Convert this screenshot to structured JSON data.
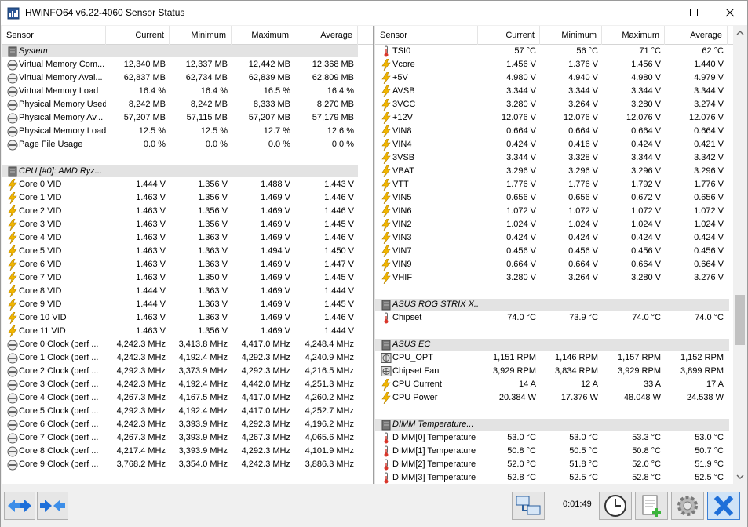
{
  "window": {
    "title": "HWiNFO64 v6.22-4060 Sensor Status"
  },
  "columns": [
    "Sensor",
    "Current",
    "Minimum",
    "Maximum",
    "Average"
  ],
  "left_rows": [
    {
      "t": "group",
      "name": "System",
      "icon": "drive"
    },
    {
      "t": "row",
      "icon": "gauge",
      "name": "Virtual Memory Com...",
      "cur": "12,340 MB",
      "min": "12,337 MB",
      "max": "12,442 MB",
      "avg": "12,368 MB"
    },
    {
      "t": "row",
      "icon": "gauge",
      "name": "Virtual Memory Avai...",
      "cur": "62,837 MB",
      "min": "62,734 MB",
      "max": "62,839 MB",
      "avg": "62,809 MB"
    },
    {
      "t": "row",
      "icon": "gauge",
      "name": "Virtual Memory Load",
      "cur": "16.4 %",
      "min": "16.4 %",
      "max": "16.5 %",
      "avg": "16.4 %"
    },
    {
      "t": "row",
      "icon": "gauge",
      "name": "Physical Memory Used",
      "cur": "8,242 MB",
      "min": "8,242 MB",
      "max": "8,333 MB",
      "avg": "8,270 MB"
    },
    {
      "t": "row",
      "icon": "gauge",
      "name": "Physical Memory Av...",
      "cur": "57,207 MB",
      "min": "57,115 MB",
      "max": "57,207 MB",
      "avg": "57,179 MB"
    },
    {
      "t": "row",
      "icon": "gauge",
      "name": "Physical Memory Load",
      "cur": "12.5 %",
      "min": "12.5 %",
      "max": "12.7 %",
      "avg": "12.6 %"
    },
    {
      "t": "row",
      "icon": "gauge",
      "name": "Page File Usage",
      "cur": "0.0 %",
      "min": "0.0 %",
      "max": "0.0 %",
      "avg": "0.0 %"
    },
    {
      "t": "blank"
    },
    {
      "t": "group",
      "name": "CPU [#0]: AMD Ryz...",
      "icon": "drive"
    },
    {
      "t": "row",
      "icon": "bolt",
      "name": "Core 0 VID",
      "cur": "1.444 V",
      "min": "1.356 V",
      "max": "1.488 V",
      "avg": "1.443 V"
    },
    {
      "t": "row",
      "icon": "bolt",
      "name": "Core 1 VID",
      "cur": "1.463 V",
      "min": "1.356 V",
      "max": "1.469 V",
      "avg": "1.446 V"
    },
    {
      "t": "row",
      "icon": "bolt",
      "name": "Core 2 VID",
      "cur": "1.463 V",
      "min": "1.356 V",
      "max": "1.469 V",
      "avg": "1.446 V"
    },
    {
      "t": "row",
      "icon": "bolt",
      "name": "Core 3 VID",
      "cur": "1.463 V",
      "min": "1.356 V",
      "max": "1.469 V",
      "avg": "1.445 V"
    },
    {
      "t": "row",
      "icon": "bolt",
      "name": "Core 4 VID",
      "cur": "1.463 V",
      "min": "1.363 V",
      "max": "1.469 V",
      "avg": "1.446 V"
    },
    {
      "t": "row",
      "icon": "bolt",
      "name": "Core 5 VID",
      "cur": "1.463 V",
      "min": "1.363 V",
      "max": "1.494 V",
      "avg": "1.450 V"
    },
    {
      "t": "row",
      "icon": "bolt",
      "name": "Core 6 VID",
      "cur": "1.463 V",
      "min": "1.363 V",
      "max": "1.469 V",
      "avg": "1.447 V"
    },
    {
      "t": "row",
      "icon": "bolt",
      "name": "Core 7 VID",
      "cur": "1.463 V",
      "min": "1.350 V",
      "max": "1.469 V",
      "avg": "1.445 V"
    },
    {
      "t": "row",
      "icon": "bolt",
      "name": "Core 8 VID",
      "cur": "1.444 V",
      "min": "1.363 V",
      "max": "1.469 V",
      "avg": "1.444 V"
    },
    {
      "t": "row",
      "icon": "bolt",
      "name": "Core 9 VID",
      "cur": "1.444 V",
      "min": "1.363 V",
      "max": "1.469 V",
      "avg": "1.445 V"
    },
    {
      "t": "row",
      "icon": "bolt",
      "name": "Core 10 VID",
      "cur": "1.463 V",
      "min": "1.363 V",
      "max": "1.469 V",
      "avg": "1.446 V"
    },
    {
      "t": "row",
      "icon": "bolt",
      "name": "Core 11 VID",
      "cur": "1.463 V",
      "min": "1.356 V",
      "max": "1.469 V",
      "avg": "1.444 V"
    },
    {
      "t": "row",
      "icon": "gauge",
      "name": "Core 0 Clock (perf ...",
      "cur": "4,242.3 MHz",
      "min": "3,413.8 MHz",
      "max": "4,417.0 MHz",
      "avg": "4,248.4 MHz"
    },
    {
      "t": "row",
      "icon": "gauge",
      "name": "Core 1 Clock (perf ...",
      "cur": "4,242.3 MHz",
      "min": "4,192.4 MHz",
      "max": "4,292.3 MHz",
      "avg": "4,240.9 MHz"
    },
    {
      "t": "row",
      "icon": "gauge",
      "name": "Core 2 Clock (perf ...",
      "cur": "4,292.3 MHz",
      "min": "3,373.9 MHz",
      "max": "4,292.3 MHz",
      "avg": "4,216.5 MHz"
    },
    {
      "t": "row",
      "icon": "gauge",
      "name": "Core 3 Clock (perf ...",
      "cur": "4,242.3 MHz",
      "min": "4,192.4 MHz",
      "max": "4,442.0 MHz",
      "avg": "4,251.3 MHz"
    },
    {
      "t": "row",
      "icon": "gauge",
      "name": "Core 4 Clock (perf ...",
      "cur": "4,267.3 MHz",
      "min": "4,167.5 MHz",
      "max": "4,417.0 MHz",
      "avg": "4,260.2 MHz"
    },
    {
      "t": "row",
      "icon": "gauge",
      "name": "Core 5 Clock (perf ...",
      "cur": "4,292.3 MHz",
      "min": "4,192.4 MHz",
      "max": "4,417.0 MHz",
      "avg": "4,252.7 MHz"
    },
    {
      "t": "row",
      "icon": "gauge",
      "name": "Core 6 Clock (perf ...",
      "cur": "4,242.3 MHz",
      "min": "3,393.9 MHz",
      "max": "4,292.3 MHz",
      "avg": "4,196.2 MHz"
    },
    {
      "t": "row",
      "icon": "gauge",
      "name": "Core 7 Clock (perf ...",
      "cur": "4,267.3 MHz",
      "min": "3,393.9 MHz",
      "max": "4,267.3 MHz",
      "avg": "4,065.6 MHz"
    },
    {
      "t": "row",
      "icon": "gauge",
      "name": "Core 8 Clock (perf ...",
      "cur": "4,217.4 MHz",
      "min": "3,393.9 MHz",
      "max": "4,292.3 MHz",
      "avg": "4,101.9 MHz"
    },
    {
      "t": "row",
      "icon": "gauge",
      "name": "Core 9 Clock (perf ...",
      "cur": "3,768.2 MHz",
      "min": "3,354.0 MHz",
      "max": "4,242.3 MHz",
      "avg": "3,886.3 MHz"
    }
  ],
  "right_rows": [
    {
      "t": "row",
      "icon": "thermo",
      "name": "TSI0",
      "cur": "57 °C",
      "min": "56 °C",
      "max": "71 °C",
      "avg": "62 °C"
    },
    {
      "t": "row",
      "icon": "bolt",
      "name": "Vcore",
      "cur": "1.456 V",
      "min": "1.376 V",
      "max": "1.456 V",
      "avg": "1.440 V"
    },
    {
      "t": "row",
      "icon": "bolt",
      "name": "+5V",
      "cur": "4.980 V",
      "min": "4.940 V",
      "max": "4.980 V",
      "avg": "4.979 V"
    },
    {
      "t": "row",
      "icon": "bolt",
      "name": "AVSB",
      "cur": "3.344 V",
      "min": "3.344 V",
      "max": "3.344 V",
      "avg": "3.344 V"
    },
    {
      "t": "row",
      "icon": "bolt",
      "name": "3VCC",
      "cur": "3.280 V",
      "min": "3.264 V",
      "max": "3.280 V",
      "avg": "3.274 V"
    },
    {
      "t": "row",
      "icon": "bolt",
      "name": "+12V",
      "cur": "12.076 V",
      "min": "12.076 V",
      "max": "12.076 V",
      "avg": "12.076 V"
    },
    {
      "t": "row",
      "icon": "bolt",
      "name": "VIN8",
      "cur": "0.664 V",
      "min": "0.664 V",
      "max": "0.664 V",
      "avg": "0.664 V"
    },
    {
      "t": "row",
      "icon": "bolt",
      "name": "VIN4",
      "cur": "0.424 V",
      "min": "0.416 V",
      "max": "0.424 V",
      "avg": "0.421 V"
    },
    {
      "t": "row",
      "icon": "bolt",
      "name": "3VSB",
      "cur": "3.344 V",
      "min": "3.328 V",
      "max": "3.344 V",
      "avg": "3.342 V"
    },
    {
      "t": "row",
      "icon": "bolt",
      "name": "VBAT",
      "cur": "3.296 V",
      "min": "3.296 V",
      "max": "3.296 V",
      "avg": "3.296 V"
    },
    {
      "t": "row",
      "icon": "bolt",
      "name": "VTT",
      "cur": "1.776 V",
      "min": "1.776 V",
      "max": "1.792 V",
      "avg": "1.776 V"
    },
    {
      "t": "row",
      "icon": "bolt",
      "name": "VIN5",
      "cur": "0.656 V",
      "min": "0.656 V",
      "max": "0.672 V",
      "avg": "0.656 V"
    },
    {
      "t": "row",
      "icon": "bolt",
      "name": "VIN6",
      "cur": "1.072 V",
      "min": "1.072 V",
      "max": "1.072 V",
      "avg": "1.072 V"
    },
    {
      "t": "row",
      "icon": "bolt",
      "name": "VIN2",
      "cur": "1.024 V",
      "min": "1.024 V",
      "max": "1.024 V",
      "avg": "1.024 V"
    },
    {
      "t": "row",
      "icon": "bolt",
      "name": "VIN3",
      "cur": "0.424 V",
      "min": "0.424 V",
      "max": "0.424 V",
      "avg": "0.424 V"
    },
    {
      "t": "row",
      "icon": "bolt",
      "name": "VIN7",
      "cur": "0.456 V",
      "min": "0.456 V",
      "max": "0.456 V",
      "avg": "0.456 V"
    },
    {
      "t": "row",
      "icon": "bolt",
      "name": "VIN9",
      "cur": "0.664 V",
      "min": "0.664 V",
      "max": "0.664 V",
      "avg": "0.664 V"
    },
    {
      "t": "row",
      "icon": "bolt",
      "name": "VHIF",
      "cur": "3.280 V",
      "min": "3.264 V",
      "max": "3.280 V",
      "avg": "3.276 V"
    },
    {
      "t": "blank"
    },
    {
      "t": "group",
      "name": "ASUS ROG STRIX X...",
      "icon": "drive"
    },
    {
      "t": "row",
      "icon": "thermo",
      "name": "Chipset",
      "cur": "74.0 °C",
      "min": "73.9 °C",
      "max": "74.0 °C",
      "avg": "74.0 °C"
    },
    {
      "t": "blank"
    },
    {
      "t": "group",
      "name": "ASUS EC",
      "icon": "drive"
    },
    {
      "t": "row",
      "icon": "fan",
      "name": "CPU_OPT",
      "cur": "1,151 RPM",
      "min": "1,146 RPM",
      "max": "1,157 RPM",
      "avg": "1,152 RPM"
    },
    {
      "t": "row",
      "icon": "fan",
      "name": "Chipset Fan",
      "cur": "3,929 RPM",
      "min": "3,834 RPM",
      "max": "3,929 RPM",
      "avg": "3,899 RPM"
    },
    {
      "t": "row",
      "icon": "bolt",
      "name": "CPU Current",
      "cur": "14 A",
      "min": "12 A",
      "max": "33 A",
      "avg": "17 A"
    },
    {
      "t": "row",
      "icon": "bolt",
      "name": "CPU Power",
      "cur": "20.384 W",
      "min": "17.376 W",
      "max": "48.048 W",
      "avg": "24.538 W"
    },
    {
      "t": "blank"
    },
    {
      "t": "group",
      "name": "DIMM Temperature...",
      "icon": "drive"
    },
    {
      "t": "row",
      "icon": "thermo",
      "name": "DIMM[0] Temperature",
      "cur": "53.0 °C",
      "min": "53.0 °C",
      "max": "53.3 °C",
      "avg": "53.0 °C"
    },
    {
      "t": "row",
      "icon": "thermo",
      "name": "DIMM[1] Temperature",
      "cur": "50.8 °C",
      "min": "50.5 °C",
      "max": "50.8 °C",
      "avg": "50.7 °C"
    },
    {
      "t": "row",
      "icon": "thermo",
      "name": "DIMM[2] Temperature",
      "cur": "52.0 °C",
      "min": "51.8 °C",
      "max": "52.0 °C",
      "avg": "51.9 °C"
    },
    {
      "t": "row",
      "icon": "thermo",
      "name": "DIMM[3] Temperature",
      "cur": "52.8 °C",
      "min": "52.5 °C",
      "max": "52.8 °C",
      "avg": "52.5 °C"
    }
  ],
  "footer": {
    "timer": "0:01:49"
  },
  "colors": {
    "accent": "#1e6fd9",
    "group_bg": "#e3e3e3",
    "bolt": "#f2b600"
  }
}
